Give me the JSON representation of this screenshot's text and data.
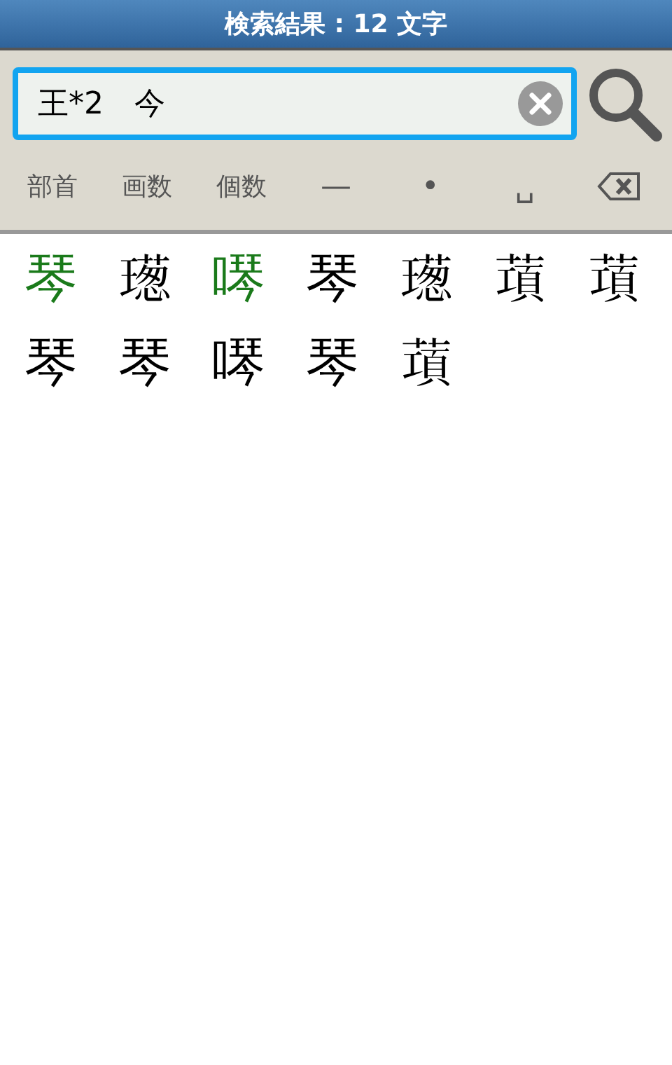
{
  "title_bar": {
    "title": "検索結果 : 12 文字"
  },
  "search": {
    "value": "王*2　今"
  },
  "keys": [
    {
      "kind": "text",
      "label": "部首"
    },
    {
      "kind": "text",
      "label": "画数"
    },
    {
      "kind": "text",
      "label": "個数"
    },
    {
      "kind": "symbol",
      "label": "—"
    },
    {
      "kind": "symbol",
      "label": "•"
    },
    {
      "kind": "symbol",
      "label": "␣"
    },
    {
      "kind": "backspace"
    }
  ],
  "results": [
    {
      "char": "琴",
      "color": "#1a7a1a"
    },
    {
      "char": "𤩿",
      "color": "#000000"
    },
    {
      "char": "噖",
      "color": "#1a7a1a"
    },
    {
      "char": "琴",
      "color": "#000000"
    },
    {
      "char": "𤩿",
      "color": "#000000"
    },
    {
      "char": "𦺣",
      "color": "#000000"
    },
    {
      "char": "𦺣",
      "color": "#000000"
    },
    {
      "char": "琴",
      "color": "#000000"
    },
    {
      "char": "琴",
      "color": "#000000"
    },
    {
      "char": "噖",
      "color": "#000000"
    },
    {
      "char": "琴",
      "color": "#000000"
    },
    {
      "char": "𦺣",
      "color": "#000000"
    }
  ]
}
